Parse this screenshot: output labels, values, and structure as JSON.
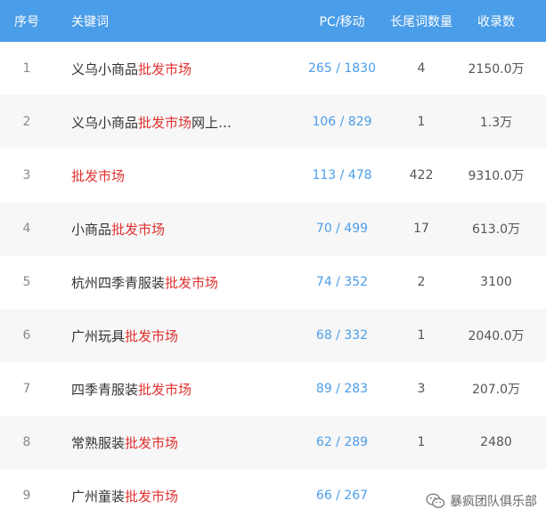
{
  "header": {
    "idx": "序号",
    "keyword": "关键词",
    "pc_mobile": "PC/移动",
    "longtail": "长尾词数量",
    "indexed": "收录数"
  },
  "rows": [
    {
      "idx": "1",
      "kw_pre": "义乌小商品",
      "kw_hl": "批发市场",
      "kw_post": "",
      "pc_mobile": "265 / 1830",
      "longtail": "4",
      "indexed": "2150.0万"
    },
    {
      "idx": "2",
      "kw_pre": "义乌小商品",
      "kw_hl": "批发市场",
      "kw_post": "网上…",
      "pc_mobile": "106 / 829",
      "longtail": "1",
      "indexed": "1.3万"
    },
    {
      "idx": "3",
      "kw_pre": "",
      "kw_hl": "批发市场",
      "kw_post": "",
      "pc_mobile": "113 / 478",
      "longtail": "422",
      "indexed": "9310.0万"
    },
    {
      "idx": "4",
      "kw_pre": "小商品",
      "kw_hl": "批发市场",
      "kw_post": "",
      "pc_mobile": "70 / 499",
      "longtail": "17",
      "indexed": "613.0万"
    },
    {
      "idx": "5",
      "kw_pre": "杭州四季青服装",
      "kw_hl": "批发市场",
      "kw_post": "",
      "pc_mobile": "74 / 352",
      "longtail": "2",
      "indexed": "3100"
    },
    {
      "idx": "6",
      "kw_pre": "广州玩具",
      "kw_hl": "批发市场",
      "kw_post": "",
      "pc_mobile": "68 / 332",
      "longtail": "1",
      "indexed": "2040.0万"
    },
    {
      "idx": "7",
      "kw_pre": "四季青服装",
      "kw_hl": "批发市场",
      "kw_post": "",
      "pc_mobile": "89 / 283",
      "longtail": "3",
      "indexed": "207.0万"
    },
    {
      "idx": "8",
      "kw_pre": "常熟服装",
      "kw_hl": "批发市场",
      "kw_post": "",
      "pc_mobile": "62 / 289",
      "longtail": "1",
      "indexed": "2480"
    },
    {
      "idx": "9",
      "kw_pre": "广州童装",
      "kw_hl": "批发市场",
      "kw_post": "",
      "pc_mobile": "66 / 267",
      "longtail": "",
      "indexed": ""
    }
  ],
  "watermark": {
    "icon": "wechat-icon",
    "text": "暴疯团队俱乐部"
  },
  "colors": {
    "header_bg": "#4a9de8",
    "highlight": "#e0312f",
    "pc_text": "#4a9de8",
    "row_alt": "#f7f7f7"
  }
}
